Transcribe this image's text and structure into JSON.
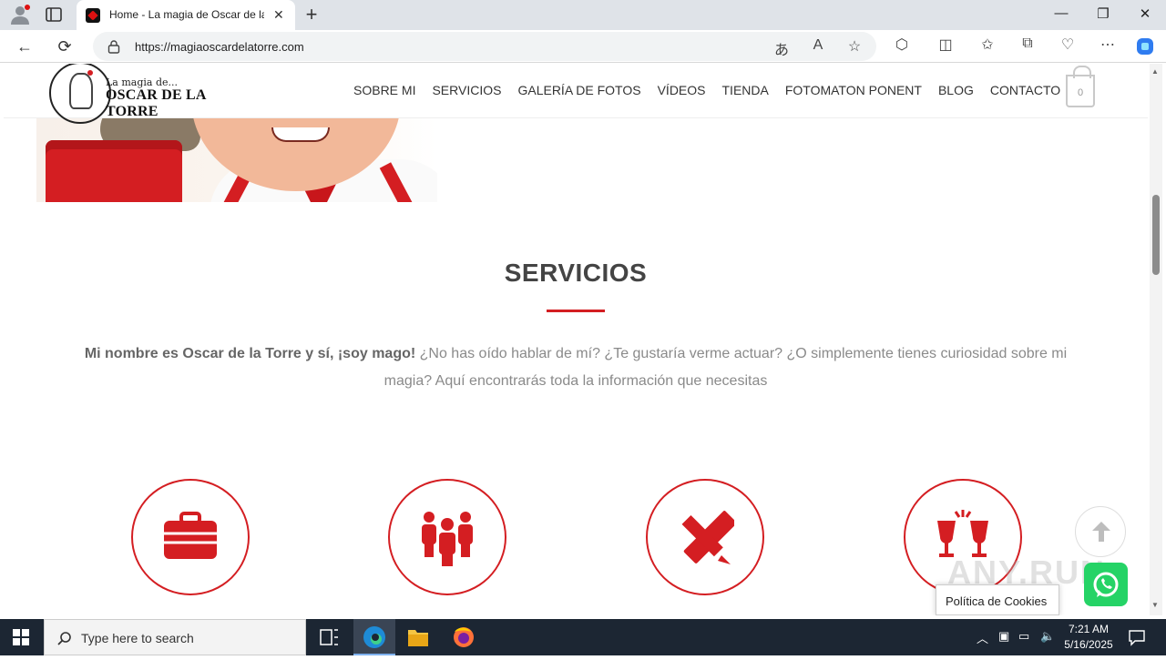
{
  "browser": {
    "tab_title": "Home - La magia de Oscar de la Torre",
    "tab_close": "✕",
    "new_tab": "+",
    "url": "https://magiaoscardelatorre.com"
  },
  "site": {
    "logo_small": "La magia de...",
    "logo_big": "OSCAR DE LA TORRE",
    "nav": [
      "SOBRE MI",
      "SERVICIOS",
      "GALERÍA DE FOTOS",
      "VÍDEOS",
      "TIENDA",
      "FOTOMATON PONENT",
      "BLOG",
      "CONTACTO"
    ],
    "cart_count": "0"
  },
  "section": {
    "title": "SERVICIOS",
    "intro_bold": "Mi nombre es Oscar de la Torre y sí, ¡soy mago!",
    "intro_rest": " ¿No has oído hablar de mí? ¿Te gustaría verme actuar? ¿O simplemente tienes curiosidad sobre mi magia? Aquí encontrarás toda la información que necesitas"
  },
  "services_icons": [
    "briefcase-icon",
    "people-icon",
    "pencil-ruler-icon",
    "toast-glasses-icon"
  ],
  "cookie_label": "Política de Cookies",
  "watermark": "ANY.RUN",
  "taskbar": {
    "search_placeholder": "Type here to search",
    "time": "7:21 AM",
    "date": "5/16/2025"
  },
  "colors": {
    "accent": "#d41e22",
    "taskbar": "#1c2633"
  }
}
